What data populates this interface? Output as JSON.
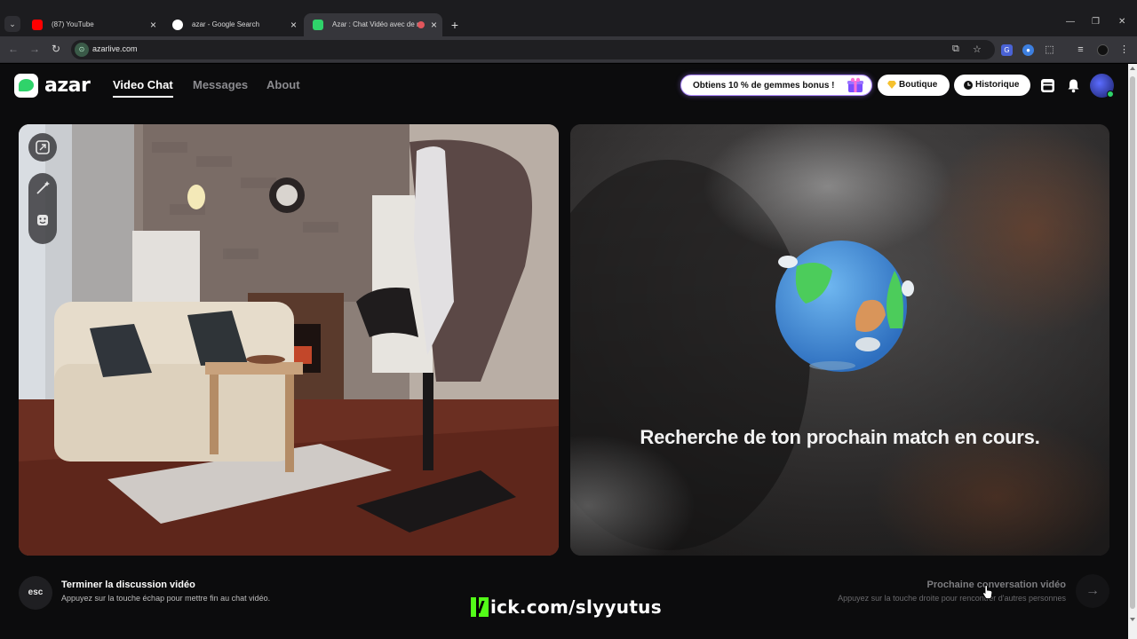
{
  "browser": {
    "tabs": [
      {
        "title": "(87) YouTube",
        "favicon": "youtube-icon",
        "color": "#ff0000"
      },
      {
        "title": "azar - Google Search",
        "favicon": "google-icon",
        "color": "#ffffff"
      },
      {
        "title": "Azar : Chat Vidéo avec de n",
        "favicon": "azar-icon",
        "color": "#2fd36a"
      }
    ],
    "url": "azarlive.com"
  },
  "header": {
    "logo_text": "azar",
    "nav": [
      "Video Chat",
      "Messages",
      "About"
    ],
    "promo_text": "Obtiens 10 % de gemmes bonus !",
    "shop_label": "Boutique",
    "history_label": "Historique"
  },
  "search": {
    "status": "Recherche de ton prochain match en cours."
  },
  "bottom": {
    "esc_key": "esc",
    "end_title": "Terminer la discussion vidéo",
    "end_sub": "Appuyez sur la touche échap pour mettre fin au chat vidéo.",
    "next_title": "Prochaine conversation vidéo",
    "next_sub": "Appuyez sur la touche droite pour rencontrer d'autres personnes"
  },
  "overlay": {
    "stream_link": "ick.com/slyyutus"
  },
  "colors": {
    "brand_green": "#2fd36a",
    "kick_green": "#53fc18",
    "page_bg": "#0c0c0d"
  }
}
